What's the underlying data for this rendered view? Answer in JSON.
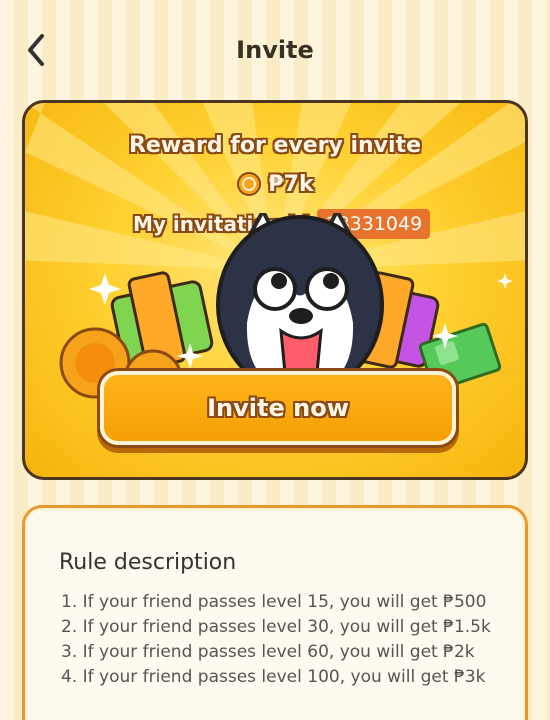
{
  "header": {
    "title": "Invite",
    "back_icon": "chevron-left-icon"
  },
  "reward": {
    "title": "Reward for every invite",
    "amount": "₱7k",
    "coin_icon": "coin-icon",
    "id_label": "My invitation id",
    "id_value": "18331049"
  },
  "invite_button": {
    "label": "Invite now"
  },
  "rules": {
    "title": "Rule description",
    "items": [
      "1. If your friend passes level 15, you will get ₱500",
      "2. If your friend passes level 30, you will get ₱1.5k",
      "3. If your friend passes level 60, you will get ₱2k",
      "4. If your friend passes level 100, you will get ₱3k"
    ]
  },
  "colors": {
    "accent": "#f6a908",
    "card_border": "#4a3520",
    "id_bg": "#e8732c",
    "rules_border": "#e59a2a"
  }
}
